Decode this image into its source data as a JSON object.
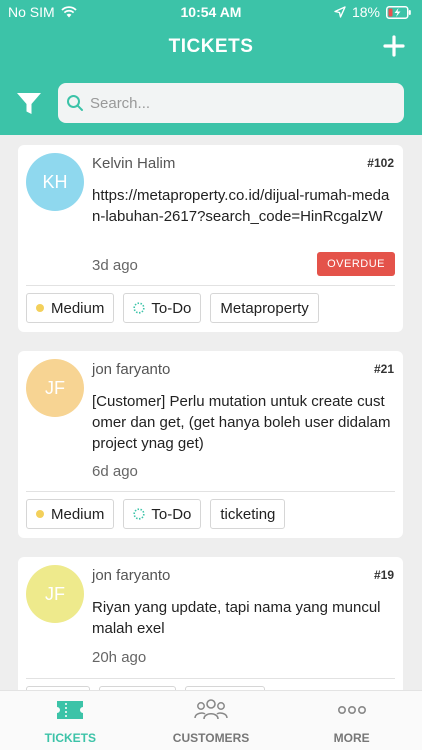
{
  "status_bar": {
    "carrier": "No SIM",
    "time": "10:54 AM",
    "battery": "18%"
  },
  "header": {
    "title": "TICKETS"
  },
  "search": {
    "placeholder": "Search..."
  },
  "tickets": [
    {
      "initials": "KH",
      "avatar_color": "#8fd8ee",
      "author": "Kelvin Halim",
      "number": "#102",
      "text": "https://metaproperty.co.id/dijual-rumah-medan-labuhan-2617?search_code=HinRcgalzW",
      "time": "3d ago",
      "badge": "OVERDUE",
      "tags": {
        "priority": "Medium",
        "status": "To-Do",
        "project": "Metaproperty"
      }
    },
    {
      "initials": "JF",
      "avatar_color": "#f7d493",
      "author": "jon faryanto",
      "number": "#21",
      "text": "[Customer] Perlu mutation untuk create customer dan get, (get hanya boleh user didalam project ynag get)",
      "time": "6d ago",
      "tags": {
        "priority": "Medium",
        "status": "To-Do",
        "project": "ticketing"
      }
    },
    {
      "initials": "JF",
      "avatar_color": "#eeea8c",
      "author": "jon faryanto",
      "number": "#19",
      "text": "Riyan yang update, tapi nama yang muncul malah exel",
      "time": "20h ago"
    }
  ],
  "tabs": [
    {
      "label": "TICKETS",
      "icon": "ticket-icon",
      "active": true
    },
    {
      "label": "CUSTOMERS",
      "icon": "customers-icon",
      "active": false
    },
    {
      "label": "MORE",
      "icon": "more-icon",
      "active": false
    }
  ],
  "colors": {
    "accent": "#3cc3a8",
    "overdue": "#e4534a",
    "priority_medium": "#f3d05b",
    "background": "#eeeeee"
  }
}
